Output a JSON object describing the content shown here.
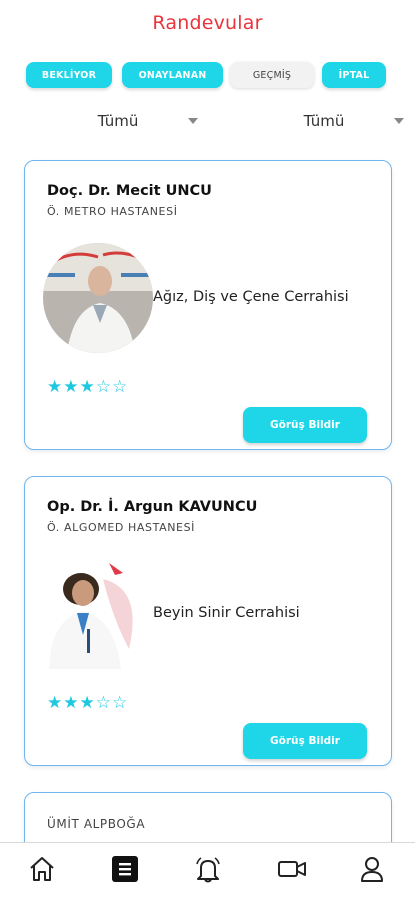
{
  "header": {
    "title": "Randevular"
  },
  "tabs": [
    {
      "label": "BEKLİYOR",
      "state": "cyan"
    },
    {
      "label": "ONAYLANAN",
      "state": "cyan"
    },
    {
      "label": "GEÇMİŞ",
      "state": "selected"
    },
    {
      "label": "İPTAL",
      "state": "cyan"
    }
  ],
  "filters": [
    {
      "value": "Tümü"
    },
    {
      "value": "Tümü"
    }
  ],
  "appointments": [
    {
      "doctor": "Doç. Dr. Mecit UNCU",
      "hospital": "Ö. METRO HASTANESİ",
      "specialty": "Ağız, Diş ve Çene Cerrahisi",
      "rating": 3,
      "max_rating": 5,
      "button": "Görüş Bildir"
    },
    {
      "doctor": "Op. Dr. İ. Argun KAVUNCU",
      "hospital": "Ö. ALGOMED HASTANESİ",
      "specialty": "Beyin Sinir Cerrahisi",
      "rating": 3,
      "max_rating": 5,
      "button": "Görüş Bildir"
    },
    {
      "doctor": "",
      "hospital": "ÜMİT ALPBOĞA"
    }
  ],
  "bottom_nav": [
    {
      "icon": "home-icon"
    },
    {
      "icon": "list-icon",
      "active": true
    },
    {
      "icon": "bell-icon"
    },
    {
      "icon": "video-icon"
    },
    {
      "icon": "user-icon"
    }
  ],
  "colors": {
    "accent": "#1ed6e8",
    "title": "#e8343c",
    "card_border": "#6fb6f0",
    "star": "#1ec9e0"
  }
}
